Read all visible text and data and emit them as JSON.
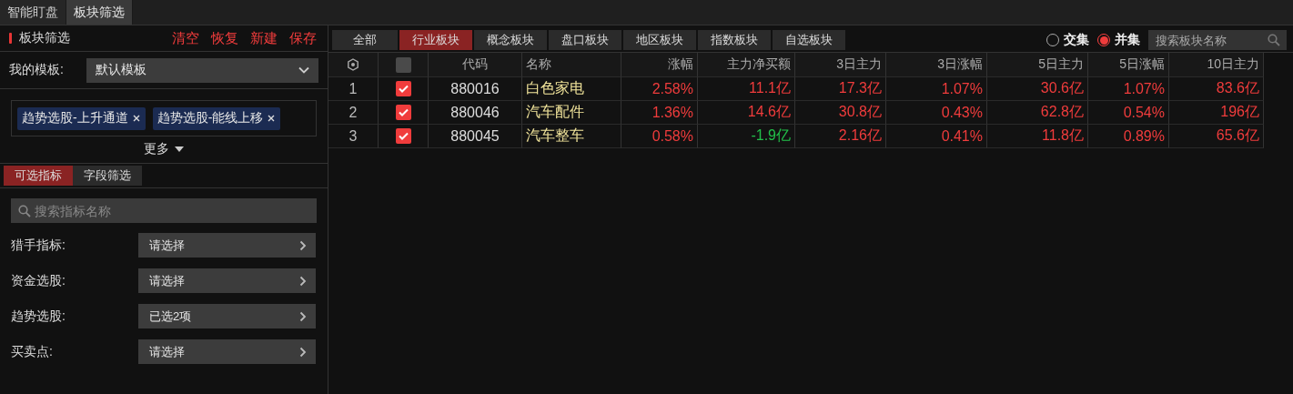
{
  "top_tabs": [
    {
      "label": "智能盯盘",
      "selected": false
    },
    {
      "label": "板块筛选",
      "selected": true
    }
  ],
  "filter_panel": {
    "title": "板块筛选",
    "actions": [
      "清空",
      "恢复",
      "新建",
      "保存"
    ],
    "template": {
      "label": "我的模板:",
      "value": "默认模板"
    },
    "tags": [
      "趋势选股-上升通道",
      "趋势选股-能线上移"
    ],
    "more": "更多",
    "sub_tabs": [
      {
        "label": "可选指标",
        "selected": true
      },
      {
        "label": "字段筛选",
        "selected": false
      }
    ],
    "search": {
      "placeholder": "搜索指标名称"
    },
    "criteria": [
      {
        "label": "猎手指标:",
        "value": "请选择"
      },
      {
        "label": "资金选股:",
        "value": "请选择"
      },
      {
        "label": "趋势选股:",
        "value": "已选2项"
      },
      {
        "label": "买卖点:",
        "value": "请选择"
      }
    ]
  },
  "board_tabs": [
    {
      "label": "全部",
      "selected": false
    },
    {
      "label": "行业板块",
      "selected": true
    },
    {
      "label": "概念板块",
      "selected": false
    },
    {
      "label": "盘口板块",
      "selected": false
    },
    {
      "label": "地区板块",
      "selected": false
    },
    {
      "label": "指数板块",
      "selected": false
    },
    {
      "label": "自选板块",
      "selected": false
    }
  ],
  "set_mode": [
    {
      "label": "交集",
      "selected": false
    },
    {
      "label": "并集",
      "selected": true
    }
  ],
  "board_search": {
    "placeholder": "搜索板块名称"
  },
  "table": {
    "header_checked": false,
    "columns": [
      "代码",
      "名称",
      "涨幅",
      "主力净买额",
      "3日主力",
      "3日涨幅",
      "5日主力",
      "5日涨幅",
      "10日主力"
    ],
    "rows": [
      {
        "index": "1",
        "checked": true,
        "code": "880016",
        "name": "白色家电",
        "values": [
          {
            "text": "2.58%",
            "color": "#f03c3c"
          },
          {
            "text": "11.1亿",
            "color": "#f03c3c"
          },
          {
            "text": "17.3亿",
            "color": "#f03c3c"
          },
          {
            "text": "1.07%",
            "color": "#f03c3c"
          },
          {
            "text": "30.6亿",
            "color": "#f03c3c"
          },
          {
            "text": "1.07%",
            "color": "#f03c3c"
          },
          {
            "text": "83.6亿",
            "color": "#f03c3c"
          }
        ]
      },
      {
        "index": "2",
        "checked": true,
        "code": "880046",
        "name": "汽车配件",
        "values": [
          {
            "text": "1.36%",
            "color": "#f03c3c"
          },
          {
            "text": "14.6亿",
            "color": "#f03c3c"
          },
          {
            "text": "30.8亿",
            "color": "#f03c3c"
          },
          {
            "text": "0.43%",
            "color": "#f03c3c"
          },
          {
            "text": "62.8亿",
            "color": "#f03c3c"
          },
          {
            "text": "0.54%",
            "color": "#f03c3c"
          },
          {
            "text": "196亿",
            "color": "#f03c3c"
          }
        ]
      },
      {
        "index": "3",
        "checked": true,
        "code": "880045",
        "name": "汽车整车",
        "values": [
          {
            "text": "0.58%",
            "color": "#f03c3c"
          },
          {
            "text": "-1.9亿",
            "color": "#22c04a"
          },
          {
            "text": "2.16亿",
            "color": "#f03c3c"
          },
          {
            "text": "0.41%",
            "color": "#f03c3c"
          },
          {
            "text": "11.8亿",
            "color": "#f03c3c"
          },
          {
            "text": "0.89%",
            "color": "#f03c3c"
          },
          {
            "text": "65.6亿",
            "color": "#f03c3c"
          }
        ]
      }
    ]
  }
}
